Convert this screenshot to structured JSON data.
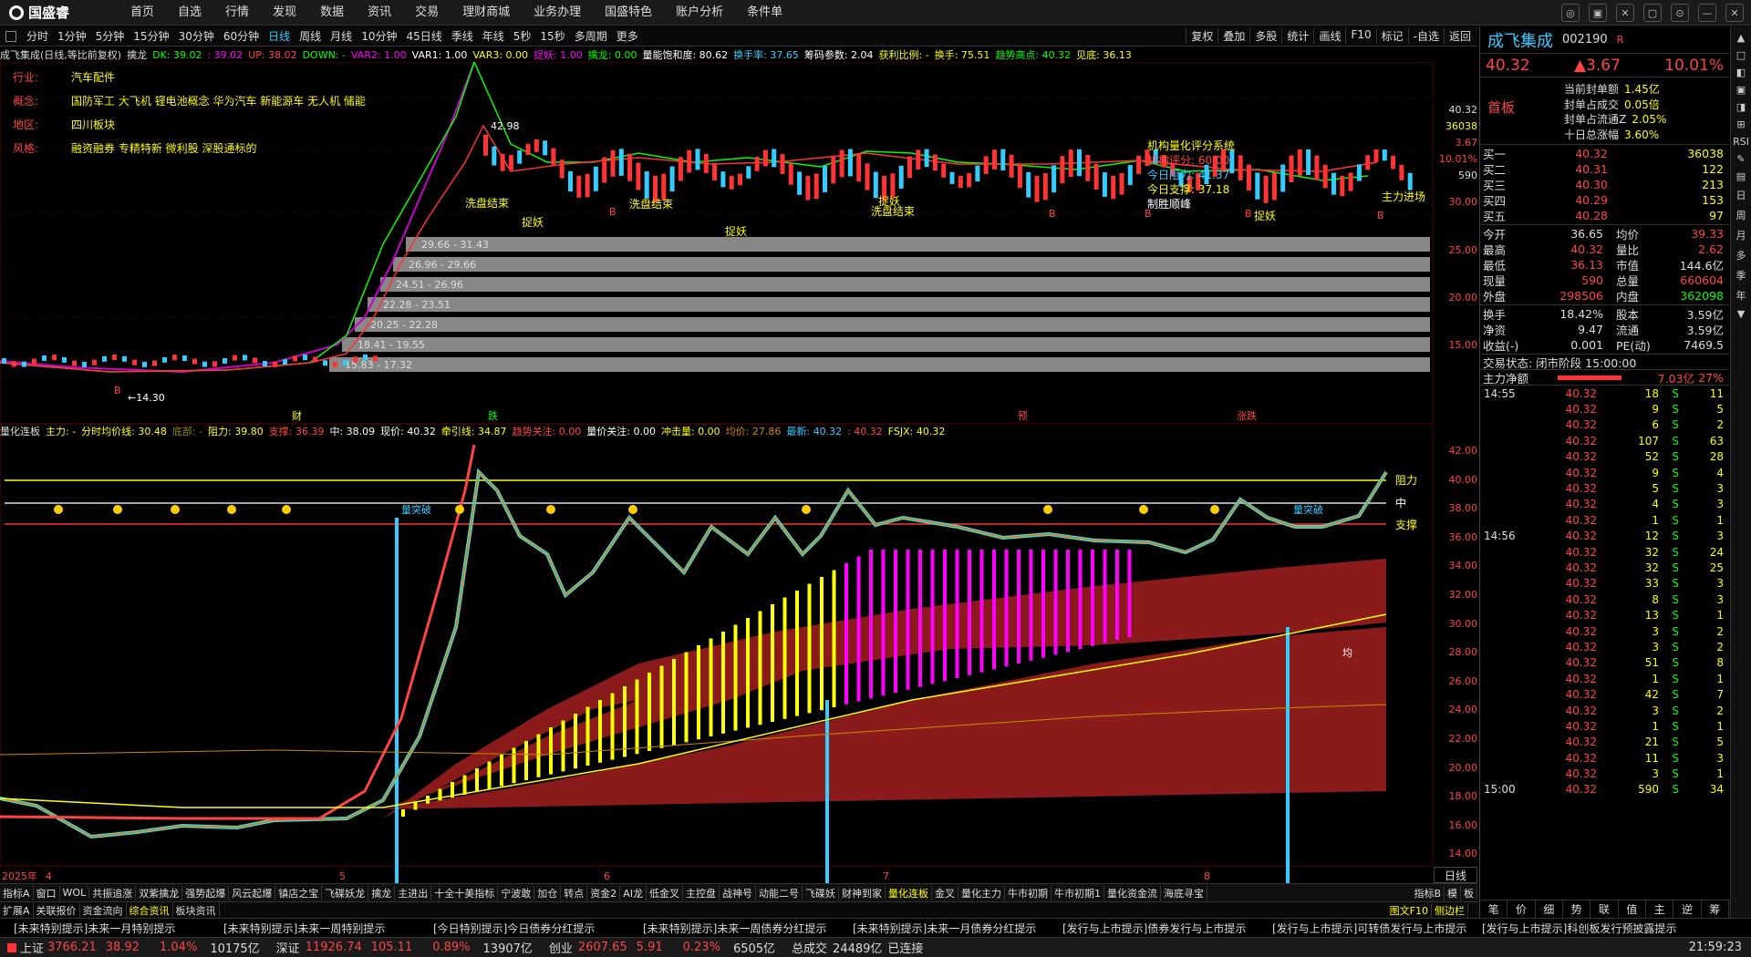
{
  "app": {
    "logo": "国盛睿"
  },
  "top_menu": [
    "首页",
    "自选",
    "行情",
    "发现",
    "数据",
    "资讯",
    "交易",
    "理财商城",
    "业务办理",
    "国盛特色",
    "账户分析",
    "条件单"
  ],
  "window_controls": [
    "◎",
    "▣",
    "✕",
    "▢",
    "⊙",
    "—",
    "✕"
  ],
  "period_bar": {
    "items": [
      "分时",
      "1分钟",
      "5分钟",
      "15分钟",
      "30分钟",
      "60分钟",
      "日线",
      "周线",
      "月线",
      "10分钟",
      "45日线",
      "季线",
      "年线",
      "5秒",
      "15秒",
      "多周期",
      "更多"
    ],
    "selected": "日线",
    "tools": [
      "复权",
      "叠加",
      "多股",
      "统计",
      "画线",
      "F10",
      "标记",
      "-自选",
      "返回"
    ]
  },
  "main_indicator_bar": [
    {
      "t": "成飞集成(日线,等比前复权)",
      "c": "#ddd"
    },
    {
      "t": "擒龙",
      "c": "#ddd"
    },
    {
      "t": "DK: 39.02",
      "c": "#0f0"
    },
    {
      "t": ": 39.02",
      "c": "#f0f"
    },
    {
      "t": "UP: 38.02",
      "c": "#f44"
    },
    {
      "t": "DOWN: -",
      "c": "#0f0"
    },
    {
      "t": "VAR2: 1.00",
      "c": "#f0f"
    },
    {
      "t": "VAR1: 1.00",
      "c": "#fff"
    },
    {
      "t": "VAR3: 0.00",
      "c": "#ff0"
    },
    {
      "t": "捉妖: 1.00",
      "c": "#f0f"
    },
    {
      "t": "擒龙: 0.00",
      "c": "#0f0"
    },
    {
      "t": "量能饱和度: 80.62",
      "c": "#fff"
    },
    {
      "t": "换手率: 37.65",
      "c": "#3cf"
    },
    {
      "t": "筹码参数: 2.04",
      "c": "#fff"
    },
    {
      "t": "获利比例: -",
      "c": "#ff0"
    },
    {
      "t": "换手: 75.51",
      "c": "#ff0"
    },
    {
      "t": "趋势高点: 40.32",
      "c": "#0f0"
    },
    {
      "t": "见底: 36.13",
      "c": "#ff0"
    }
  ],
  "info": {
    "industry_label": "行业:",
    "industry": "汽车配件",
    "concept_label": "概念:",
    "concept": "国防军工 大飞机 锂电池概念 华为汽车 新能源车 无人机 储能",
    "region_label": "地区:",
    "region": "四川板块",
    "style_label": "风格:",
    "style": "融资融券 专精特新 微利股 深股通标的"
  },
  "upper_axis": [
    "40.32",
    "36038",
    "3.67",
    "10.01%",
    "590",
    "30.00",
    "25.00",
    "20.00",
    "15.00"
  ],
  "lower_axis": [
    "42.00",
    "40.00",
    "38.00",
    "36.00",
    "34.00",
    "32.00",
    "30.00",
    "28.00",
    "26.00",
    "24.00",
    "22.00",
    "20.00",
    "18.00",
    "16.00",
    "14.00"
  ],
  "chart_labels": {
    "peak": "42.98",
    "low": "14.30",
    "chip_ranges": [
      "29.66 - 31.43",
      "26.96 - 29.66",
      "24.51 - 26.96",
      "22.28 - 23.51",
      "20.25 - 22.28",
      "18.41 - 19.55",
      "15.83 - 17.32"
    ],
    "annotations": [
      "洗盘结束",
      "洗盘结束",
      "洗盘结束",
      "捉妖",
      "捉妖",
      "捉妖",
      "捉妖",
      "主力进场"
    ],
    "org_title": "机构量化评分系统",
    "org_lines": [
      "机构评分: 60.00",
      "今日阻力: 41.37",
      "今日支撑: 37.18",
      "制胜顺峰"
    ],
    "letters": [
      "B",
      "B",
      "B",
      "B",
      "B",
      "B"
    ],
    "lower_marks": [
      "财",
      "跌",
      "预",
      "涨跌"
    ]
  },
  "sub_indicator_bar": [
    {
      "t": "量化连板",
      "c": "#ddd"
    },
    {
      "t": "主力: -",
      "c": "#ff0"
    },
    {
      "t": "分时均价线: 30.48",
      "c": "#ff0"
    },
    {
      "t": "底部: -",
      "c": "#880"
    },
    {
      "t": "阻力: 39.80",
      "c": "#ff0"
    },
    {
      "t": "支撑: 36.39",
      "c": "#f44"
    },
    {
      "t": "中: 38.09",
      "c": "#fff"
    },
    {
      "t": "现价: 40.32",
      "c": "#fff"
    },
    {
      "t": "牵引线: 34.87",
      "c": "#ff0"
    },
    {
      "t": "趋势关注: 0.00",
      "c": "#f44"
    },
    {
      "t": "量价关注: 0.00",
      "c": "#fff"
    },
    {
      "t": "冲击量: 0.00",
      "c": "#ff0"
    },
    {
      "t": "均价: 27.86",
      "c": "#c80"
    },
    {
      "t": "最新: 40.32",
      "c": "#3cf"
    },
    {
      "t": ": 40.32",
      "c": "#f44"
    },
    {
      "t": "FSJX: 40.32",
      "c": "#ff0"
    }
  ],
  "lower_labels": {
    "resist": "阻力",
    "mid": "中",
    "support": "支撑",
    "breakout": "量突破",
    "avg": "均"
  },
  "date_axis": [
    "2025年",
    "4",
    "5",
    "6",
    "7",
    "8"
  ],
  "formula_tabs": [
    "指标A",
    "窗口",
    "WOL",
    "共振追涨",
    "双紫擒龙",
    "强势起爆",
    "风云起爆",
    "镇店之宝",
    "飞碟妖龙",
    "擒龙",
    "主进出",
    "十全十美指标",
    "宁波敢",
    "加仓",
    "转点",
    "资金2",
    "AI龙",
    "低金叉",
    "主控盘",
    "战神号",
    "动能二号",
    "飞碟妖",
    "财神到家",
    "量化连板",
    "金叉",
    "量化主力",
    "牛市初期",
    "牛市初期1",
    "量化资金流",
    "海底寻宝"
  ],
  "formula_tabs_right": [
    "指标B",
    "模",
    "板"
  ],
  "formula_tabs_selected": "量化连板",
  "bottom_tabs": [
    "扩展A",
    "关联报价",
    "资金流向",
    "综合资讯",
    "板块资讯"
  ],
  "bottom_tabs_right": [
    "图文F10",
    "侧边栏"
  ],
  "news": [
    "[未来特别提示]未来一月特别提示",
    "[未来特别提示]未来一周特别提示",
    "[今日特别提示]今日债券分红提示",
    "[未来特别提示]未来一周债券分红提示",
    "[未来特别提示]未来一月债券分红提示",
    "[发行与上市提示]债券发行与上市提示",
    "[发行与上市提示]可转债发行与上市提示",
    "[发行与上市提示]科创板发行预披露提示"
  ],
  "status": {
    "sh_label": "上证",
    "sh": "3766.21",
    "sh_chg": "38.92",
    "sh_pct": "1.04%",
    "sh_amt": "10175亿",
    "sz_label": "深证",
    "sz": "11926.74",
    "sz_chg": "105.11",
    "sz_pct": "0.89%",
    "sz_amt": "13907亿",
    "cy_label": "创业",
    "cy": "2607.65",
    "cy_chg": "5.91",
    "cy_pct": "0.23%",
    "cy_amt": "6505亿",
    "total_label": "总成交",
    "total": "24489亿",
    "conn": "已连接",
    "time": "21:59:23"
  },
  "quote": {
    "name": "成飞集成",
    "code": "002190",
    "flag": "R",
    "price": "40.32",
    "change": "▲3.67",
    "pct": "10.01%",
    "board_label": "首板",
    "seal_rows": [
      [
        "当前封单额",
        "1.45亿"
      ],
      [
        "封单占成交",
        "0.05倍"
      ],
      [
        "封单占流通Z",
        "2.05%"
      ],
      [
        "十日总涨幅",
        "3.60%"
      ]
    ],
    "order_book": [
      [
        "买一",
        "40.32",
        "36038"
      ],
      [
        "买二",
        "40.31",
        "122"
      ],
      [
        "买三",
        "40.30",
        "213"
      ],
      [
        "买四",
        "40.29",
        "153"
      ],
      [
        "买五",
        "40.28",
        "97"
      ]
    ],
    "stats": [
      [
        "今开",
        "36.65",
        "均价",
        "39.33"
      ],
      [
        "最高",
        "40.32",
        "量比",
        "2.62"
      ],
      [
        "最低",
        "36.13",
        "市值",
        "144.6亿"
      ],
      [
        "现量",
        "590",
        "总量",
        "660604"
      ],
      [
        "外盘",
        "298506",
        "内盘",
        "362098"
      ]
    ],
    "stats2": [
      [
        "换手",
        "18.42%",
        "股本",
        "3.59亿"
      ],
      [
        "净资",
        "9.47",
        "流通",
        "3.59亿"
      ],
      [
        "收益(-)",
        "0.001",
        "PE(动)",
        "7469.5"
      ]
    ],
    "trade_state": "交易状态: 闭市阶段 15:00:00",
    "netflow_label": "主力净额",
    "netflow": "7.03亿",
    "netflow_pct": "27%",
    "ticks": [
      [
        "14:55",
        "40.32",
        "18",
        "S",
        "11"
      ],
      [
        "",
        "40.32",
        "9",
        "S",
        "5"
      ],
      [
        "",
        "40.32",
        "6",
        "S",
        "2"
      ],
      [
        "",
        "40.32",
        "107",
        "S",
        "63"
      ],
      [
        "",
        "40.32",
        "52",
        "S",
        "28"
      ],
      [
        "",
        "40.32",
        "9",
        "S",
        "4"
      ],
      [
        "",
        "40.32",
        "5",
        "S",
        "3"
      ],
      [
        "",
        "40.32",
        "4",
        "S",
        "3"
      ],
      [
        "",
        "40.32",
        "1",
        "S",
        "1"
      ],
      [
        "14:56",
        "40.32",
        "12",
        "S",
        "3"
      ],
      [
        "",
        "40.32",
        "32",
        "S",
        "24"
      ],
      [
        "",
        "40.32",
        "32",
        "S",
        "25"
      ],
      [
        "",
        "40.32",
        "33",
        "S",
        "3"
      ],
      [
        "",
        "40.32",
        "8",
        "S",
        "3"
      ],
      [
        "",
        "40.32",
        "13",
        "S",
        "1"
      ],
      [
        "",
        "40.32",
        "3",
        "S",
        "2"
      ],
      [
        "",
        "40.32",
        "3",
        "S",
        "2"
      ],
      [
        "",
        "40.32",
        "51",
        "S",
        "8"
      ],
      [
        "",
        "40.32",
        "1",
        "S",
        "1"
      ],
      [
        "",
        "40.32",
        "42",
        "S",
        "7"
      ],
      [
        "",
        "40.32",
        "3",
        "S",
        "2"
      ],
      [
        "",
        "40.32",
        "1",
        "S",
        "1"
      ],
      [
        "",
        "40.32",
        "21",
        "S",
        "5"
      ],
      [
        "",
        "40.32",
        "11",
        "S",
        "3"
      ],
      [
        "",
        "40.32",
        "3",
        "S",
        "1"
      ],
      [
        "15:00",
        "40.32",
        "590",
        "S",
        "34"
      ]
    ],
    "tabs": [
      "笔",
      "价",
      "细",
      "势",
      "联",
      "值",
      "主",
      "逆",
      "筹"
    ]
  },
  "side_strip": [
    "▲",
    "□",
    "◧",
    "▣",
    "◨",
    "⊞",
    "RSI",
    "✎",
    "▤",
    "日",
    "周",
    "月",
    "多",
    "季",
    "年",
    "▼"
  ]
}
